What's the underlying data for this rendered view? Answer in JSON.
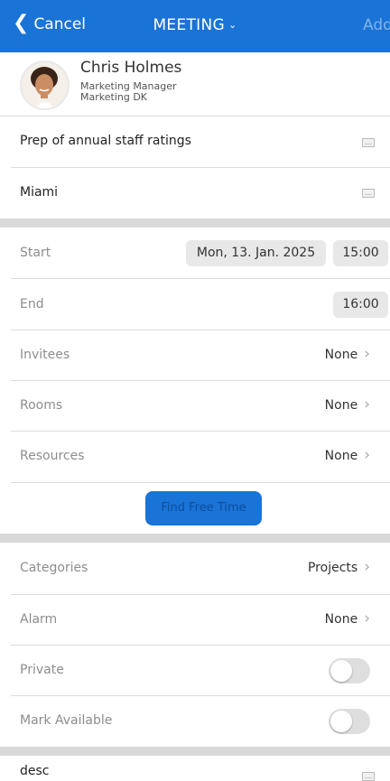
{
  "nav": {
    "cancel_label": "Cancel",
    "title": "MEETING",
    "add_label": "Add"
  },
  "profile": {
    "name": "Chris Holmes",
    "role": "Marketing Manager",
    "department": "Marketing DK"
  },
  "subject": {
    "value": "Prep of annual staff ratings"
  },
  "location": {
    "value": "Miami"
  },
  "start": {
    "label": "Start",
    "date": "Mon, 13. Jan. 2025",
    "time": "15:00"
  },
  "end": {
    "label": "End",
    "time": "16:00"
  },
  "invitees": {
    "label": "Invitees",
    "value": "None"
  },
  "rooms": {
    "label": "Rooms",
    "value": "None"
  },
  "resources": {
    "label": "Resources",
    "value": "None"
  },
  "find_free_time": {
    "label": "Find Free Time"
  },
  "categories": {
    "label": "Categories",
    "value": "Projects"
  },
  "alarm": {
    "label": "Alarm",
    "value": "None"
  },
  "private": {
    "label": "Private",
    "on": false
  },
  "mark_available": {
    "label": "Mark Available",
    "on": false
  },
  "description": {
    "value": "desc"
  },
  "colors": {
    "accent": "#1a73d6",
    "band": "#d9d9d9",
    "toggle_off": "#dedede"
  }
}
